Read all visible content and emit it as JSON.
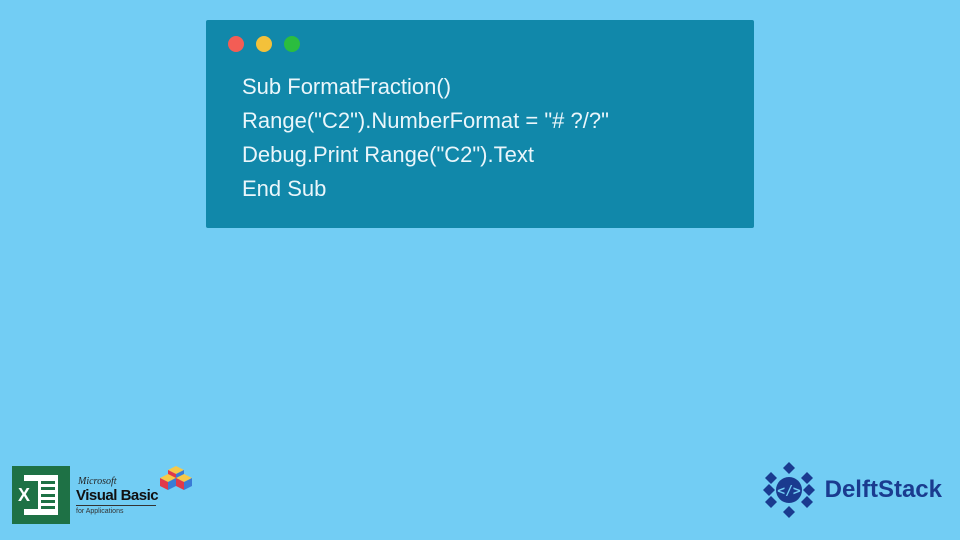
{
  "code": {
    "lines": [
      "Sub FormatFraction()",
      "Range(\"C2\").NumberFormat = \"# ?/?\"",
      "Debug.Print Range(\"C2\").Text",
      "End Sub"
    ]
  },
  "footer": {
    "excel_letter": "X",
    "vb_microsoft": "Microsoft",
    "vb_title": "Visual Basic",
    "vb_subtitle": "for Applications",
    "delft_label": "DelftStack"
  }
}
